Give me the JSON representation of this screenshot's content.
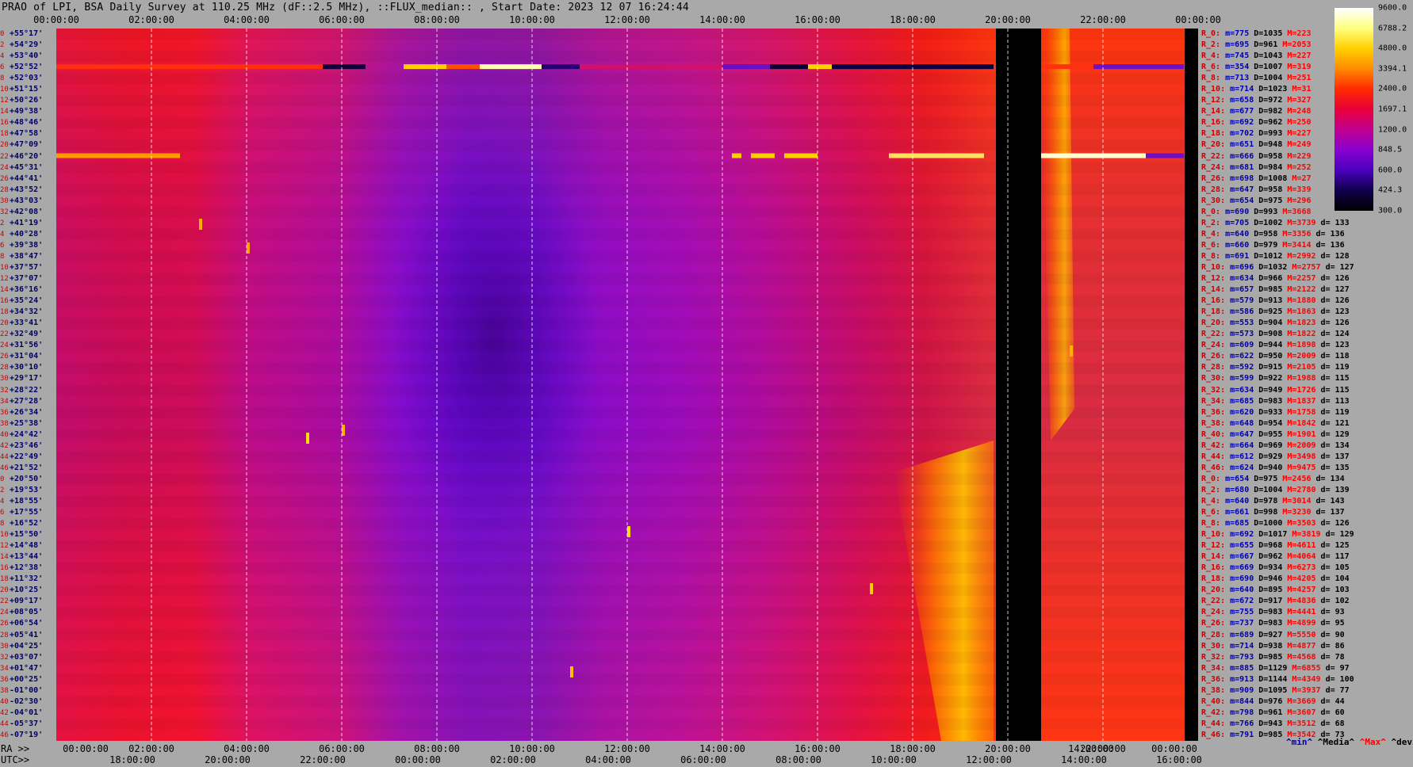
{
  "title": "PRAO of LPI, BSA Daily Survey at 110.25 MHz (dF::2.5 MHz), ::FLUX_median:: , Start Date: 2023 12 07 16:24:44",
  "axes": {
    "top_ticks": [
      "00:00:00",
      "02:00:00",
      "04:00:00",
      "06:00:00",
      "08:00:00",
      "10:00:00",
      "12:00:00",
      "14:00:00",
      "16:00:00",
      "18:00:00",
      "20:00:00",
      "22:00:00",
      "00:00:00"
    ],
    "ra_prefix": "RA >>",
    "ra_ticks": [
      "00:00:00",
      "02:00:00",
      "04:00:00",
      "06:00:00",
      "08:00:00",
      "10:00:00",
      "12:00:00",
      "14:00:00",
      "16:00:00",
      "18:00:00",
      "20:00:00",
      "14:00:00",
      "22:00:00",
      "00:00:00"
    ],
    "utc_prefix": "UTC>>",
    "utc_ticks": [
      "18:00:00",
      "20:00:00",
      "22:00:00",
      "00:00:00",
      "02:00:00",
      "04:00:00",
      "06:00:00",
      "08:00:00",
      "10:00:00",
      "12:00:00",
      "14:00:00",
      "16:00:00"
    ]
  },
  "colorbar": {
    "labels": [
      "9600.0",
      "6788.2",
      "4800.0",
      "3394.1",
      "2400.0",
      "1697.1",
      "1200.0",
      "848.5",
      "600.0",
      "424.3",
      "300.0"
    ],
    "colors": [
      "#ffffff",
      "#ffff80",
      "#ffd000",
      "#ff8a00",
      "#ff2a00",
      "#e8003a",
      "#c00090",
      "#8a00d0",
      "#4a00c0",
      "#10004a",
      "#000000"
    ]
  },
  "footer": {
    "min": "^min^",
    "median": "^Media^",
    "max": "^Max^",
    "devia": "^devia^"
  },
  "rows": [
    {
      "i": "0",
      "dec": "+55°17'"
    },
    {
      "i": "2",
      "dec": "+54°29'"
    },
    {
      "i": "4",
      "dec": "+53°40'"
    },
    {
      "i": "6",
      "dec": "+52°52'"
    },
    {
      "i": "8",
      "dec": "+52°03'"
    },
    {
      "i": "10",
      "dec": "+51°15'"
    },
    {
      "i": "12",
      "dec": "+50°26'"
    },
    {
      "i": "14",
      "dec": "+49°38'"
    },
    {
      "i": "16",
      "dec": "+48°46'"
    },
    {
      "i": "18",
      "dec": "+47°58'"
    },
    {
      "i": "20",
      "dec": "+47°09'"
    },
    {
      "i": "22",
      "dec": "+46°20'"
    },
    {
      "i": "24",
      "dec": "+45°31'"
    },
    {
      "i": "26",
      "dec": "+44°41'"
    },
    {
      "i": "28",
      "dec": "+43°52'"
    },
    {
      "i": "30",
      "dec": "+43°03'"
    },
    {
      "i": "32",
      "dec": "+42°08'"
    },
    {
      "i": "2",
      "dec": "+41°19'"
    },
    {
      "i": "4",
      "dec": "+40°28'"
    },
    {
      "i": "6",
      "dec": "+39°38'"
    },
    {
      "i": "8",
      "dec": "+38°47'"
    },
    {
      "i": "10",
      "dec": "+37°57'"
    },
    {
      "i": "12",
      "dec": "+37°07'"
    },
    {
      "i": "14",
      "dec": "+36°16'"
    },
    {
      "i": "16",
      "dec": "+35°24'"
    },
    {
      "i": "18",
      "dec": "+34°32'"
    },
    {
      "i": "20",
      "dec": "+33°41'"
    },
    {
      "i": "22",
      "dec": "+32°49'"
    },
    {
      "i": "24",
      "dec": "+31°56'"
    },
    {
      "i": "26",
      "dec": "+31°04'"
    },
    {
      "i": "28",
      "dec": "+30°10'"
    },
    {
      "i": "30",
      "dec": "+29°17'"
    },
    {
      "i": "32",
      "dec": "+28°22'"
    },
    {
      "i": "34",
      "dec": "+27°28'"
    },
    {
      "i": "36",
      "dec": "+26°34'"
    },
    {
      "i": "38",
      "dec": "+25°38'"
    },
    {
      "i": "40",
      "dec": "+24°42'"
    },
    {
      "i": "42",
      "dec": "+23°46'"
    },
    {
      "i": "44",
      "dec": "+22°49'"
    },
    {
      "i": "46",
      "dec": "+21°52'"
    },
    {
      "i": "0",
      "dec": "+20°50'"
    },
    {
      "i": "2",
      "dec": "+19°53'"
    },
    {
      "i": "4",
      "dec": "+18°55'"
    },
    {
      "i": "6",
      "dec": "+17°55'"
    },
    {
      "i": "8",
      "dec": "+16°52'"
    },
    {
      "i": "10",
      "dec": "+15°50'"
    },
    {
      "i": "12",
      "dec": "+14°48'"
    },
    {
      "i": "14",
      "dec": "+13°44'"
    },
    {
      "i": "16",
      "dec": "+12°38'"
    },
    {
      "i": "18",
      "dec": "+11°32'"
    },
    {
      "i": "20",
      "dec": "+10°25'"
    },
    {
      "i": "22",
      "dec": "+09°17'"
    },
    {
      "i": "24",
      "dec": "+08°05'"
    },
    {
      "i": "26",
      "dec": "+06°54'"
    },
    {
      "i": "28",
      "dec": "+05°41'"
    },
    {
      "i": "30",
      "dec": "+04°25'"
    },
    {
      "i": "32",
      "dec": "+03°07'"
    },
    {
      "i": "34",
      "dec": "+01°47'"
    },
    {
      "i": "36",
      "dec": "+00°25'"
    },
    {
      "i": "38",
      "dec": "-01°00'"
    },
    {
      "i": "40",
      "dec": "-02°30'"
    },
    {
      "i": "42",
      "dec": "-04°01'"
    },
    {
      "i": "44",
      "dec": "-05°37'"
    },
    {
      "i": "46",
      "dec": "-07°19'"
    }
  ],
  "stats": [
    {
      "r": "R_0:",
      "m": "775",
      "D": "1035",
      "M": "223",
      "d": ""
    },
    {
      "r": "R_2:",
      "m": "695",
      "D": "961",
      "M": "2053",
      "d": ""
    },
    {
      "r": "R_4:",
      "m": "745",
      "D": "1043",
      "M": "227",
      "d": ""
    },
    {
      "r": "R_6:",
      "m": "354",
      "D": "1007",
      "M": "319",
      "d": ""
    },
    {
      "r": "R_8:",
      "m": "713",
      "D": "1004",
      "M": "251",
      "d": ""
    },
    {
      "r": "R_10:",
      "m": "714",
      "D": "1023",
      "M": "31",
      "d": ""
    },
    {
      "r": "R_12:",
      "m": "658",
      "D": "972",
      "M": "327",
      "d": ""
    },
    {
      "r": "R_14:",
      "m": "677",
      "D": "982",
      "M": "248",
      "d": ""
    },
    {
      "r": "R_16:",
      "m": "692",
      "D": "962",
      "M": "250",
      "d": ""
    },
    {
      "r": "R_18:",
      "m": "702",
      "D": "993",
      "M": "227",
      "d": ""
    },
    {
      "r": "R_20:",
      "m": "651",
      "D": "948",
      "M": "249",
      "d": ""
    },
    {
      "r": "R_22:",
      "m": "666",
      "D": "958",
      "M": "229",
      "d": ""
    },
    {
      "r": "R_24:",
      "m": "681",
      "D": "984",
      "M": "252",
      "d": ""
    },
    {
      "r": "R_26:",
      "m": "698",
      "D": "1008",
      "M": "27",
      "d": ""
    },
    {
      "r": "R_28:",
      "m": "647",
      "D": "958",
      "M": "339",
      "d": ""
    },
    {
      "r": "R_30:",
      "m": "654",
      "D": "975",
      "M": "296",
      "d": ""
    },
    {
      "r": "R_0:",
      "m": "690",
      "D": "993",
      "M": "3668",
      "d": ""
    },
    {
      "r": "R_2:",
      "m": "705",
      "D": "1002",
      "M": "3739",
      "d": "133"
    },
    {
      "r": "R_4:",
      "m": "640",
      "D": "958",
      "M": "3356",
      "d": "136"
    },
    {
      "r": "R_6:",
      "m": "660",
      "D": "979",
      "M": "3414",
      "d": "136"
    },
    {
      "r": "R_8:",
      "m": "691",
      "D": "1012",
      "M": "2992",
      "d": "128"
    },
    {
      "r": "R_10:",
      "m": "696",
      "D": "1032",
      "M": "2757",
      "d": "127"
    },
    {
      "r": "R_12:",
      "m": "634",
      "D": "966",
      "M": "2257",
      "d": "126"
    },
    {
      "r": "R_14:",
      "m": "657",
      "D": "985",
      "M": "2122",
      "d": "127"
    },
    {
      "r": "R_16:",
      "m": "579",
      "D": "913",
      "M": "1880",
      "d": "126"
    },
    {
      "r": "R_18:",
      "m": "586",
      "D": "925",
      "M": "1863",
      "d": "123"
    },
    {
      "r": "R_20:",
      "m": "553",
      "D": "904",
      "M": "1823",
      "d": "126"
    },
    {
      "r": "R_22:",
      "m": "573",
      "D": "908",
      "M": "1822",
      "d": "124"
    },
    {
      "r": "R_24:",
      "m": "609",
      "D": "944",
      "M": "1898",
      "d": "123"
    },
    {
      "r": "R_26:",
      "m": "622",
      "D": "950",
      "M": "2009",
      "d": "118"
    },
    {
      "r": "R_28:",
      "m": "592",
      "D": "915",
      "M": "2105",
      "d": "119"
    },
    {
      "r": "R_30:",
      "m": "599",
      "D": "922",
      "M": "1988",
      "d": "115"
    },
    {
      "r": "R_32:",
      "m": "634",
      "D": "949",
      "M": "1726",
      "d": "115"
    },
    {
      "r": "R_34:",
      "m": "685",
      "D": "983",
      "M": "1837",
      "d": "113"
    },
    {
      "r": "R_36:",
      "m": "620",
      "D": "933",
      "M": "1758",
      "d": "119"
    },
    {
      "r": "R_38:",
      "m": "648",
      "D": "954",
      "M": "1842",
      "d": "121"
    },
    {
      "r": "R_40:",
      "m": "647",
      "D": "955",
      "M": "1901",
      "d": "129"
    },
    {
      "r": "R_42:",
      "m": "664",
      "D": "969",
      "M": "2009",
      "d": "134"
    },
    {
      "r": "R_44:",
      "m": "612",
      "D": "929",
      "M": "3498",
      "d": "137"
    },
    {
      "r": "R_46:",
      "m": "624",
      "D": "940",
      "M": "9475",
      "d": "135"
    },
    {
      "r": "R_0:",
      "m": "654",
      "D": "975",
      "M": "2456",
      "d": "134"
    },
    {
      "r": "R_2:",
      "m": "680",
      "D": "1004",
      "M": "2780",
      "d": "139"
    },
    {
      "r": "R_4:",
      "m": "640",
      "D": "978",
      "M": "3014",
      "d": "143"
    },
    {
      "r": "R_6:",
      "m": "661",
      "D": "998",
      "M": "3230",
      "d": "137"
    },
    {
      "r": "R_8:",
      "m": "685",
      "D": "1000",
      "M": "3503",
      "d": "126"
    },
    {
      "r": "R_10:",
      "m": "692",
      "D": "1017",
      "M": "3819",
      "d": "129"
    },
    {
      "r": "R_12:",
      "m": "655",
      "D": "968",
      "M": "4611",
      "d": "125"
    },
    {
      "r": "R_14:",
      "m": "667",
      "D": "962",
      "M": "4064",
      "d": "117"
    },
    {
      "r": "R_16:",
      "m": "669",
      "D": "934",
      "M": "6273",
      "d": "105"
    },
    {
      "r": "R_18:",
      "m": "690",
      "D": "946",
      "M": "4205",
      "d": "104"
    },
    {
      "r": "R_20:",
      "m": "640",
      "D": "895",
      "M": "4257",
      "d": "103"
    },
    {
      "r": "R_22:",
      "m": "672",
      "D": "917",
      "M": "4836",
      "d": "102"
    },
    {
      "r": "R_24:",
      "m": "755",
      "D": "983",
      "M": "4441",
      "d": "93"
    },
    {
      "r": "R_26:",
      "m": "737",
      "D": "983",
      "M": "4899",
      "d": "95"
    },
    {
      "r": "R_28:",
      "m": "689",
      "D": "927",
      "M": "5550",
      "d": "90"
    },
    {
      "r": "R_30:",
      "m": "714",
      "D": "938",
      "M": "4877",
      "d": "86"
    },
    {
      "r": "R_32:",
      "m": "793",
      "D": "985",
      "M": "4568",
      "d": "78"
    },
    {
      "r": "R_34:",
      "m": "885",
      "D": "1129",
      "M": "6855",
      "d": "97"
    },
    {
      "r": "R_36:",
      "m": "913",
      "D": "1144",
      "M": "4349",
      "d": "100"
    },
    {
      "r": "R_38:",
      "m": "909",
      "D": "1095",
      "M": "3937",
      "d": "77"
    },
    {
      "r": "R_40:",
      "m": "844",
      "D": "976",
      "M": "3669",
      "d": "44"
    },
    {
      "r": "R_42:",
      "m": "798",
      "D": "961",
      "M": "3607",
      "d": "60"
    },
    {
      "r": "R_44:",
      "m": "766",
      "D": "943",
      "M": "3512",
      "d": "68"
    },
    {
      "r": "R_46:",
      "m": "791",
      "D": "985",
      "M": "3542",
      "d": "73"
    }
  ],
  "chart_data": {
    "type": "heatmap",
    "title": "PRAO of LPI, BSA Daily Survey at 110.25 MHz (dF::2.5 MHz), ::FLUX_median:: , Start Date: 2023 12 07 16:24:44",
    "x_axis_top": "RA hh:mm:ss, 00:00:00 to 24:00:00",
    "y_axis": "Declination, +55°17' to -07°19' (64 rows)",
    "color_scale": [
      300.0,
      424.3,
      600.0,
      848.5,
      1200.0,
      1697.1,
      2400.0,
      3394.1,
      4800.0,
      6788.2,
      9600.0
    ],
    "data_gaps_hours": [
      [
        19.7,
        20.7
      ],
      [
        23.7,
        24.0
      ]
    ],
    "bright_rows_dec": [
      "+52°52'",
      "+46°20'"
    ]
  }
}
